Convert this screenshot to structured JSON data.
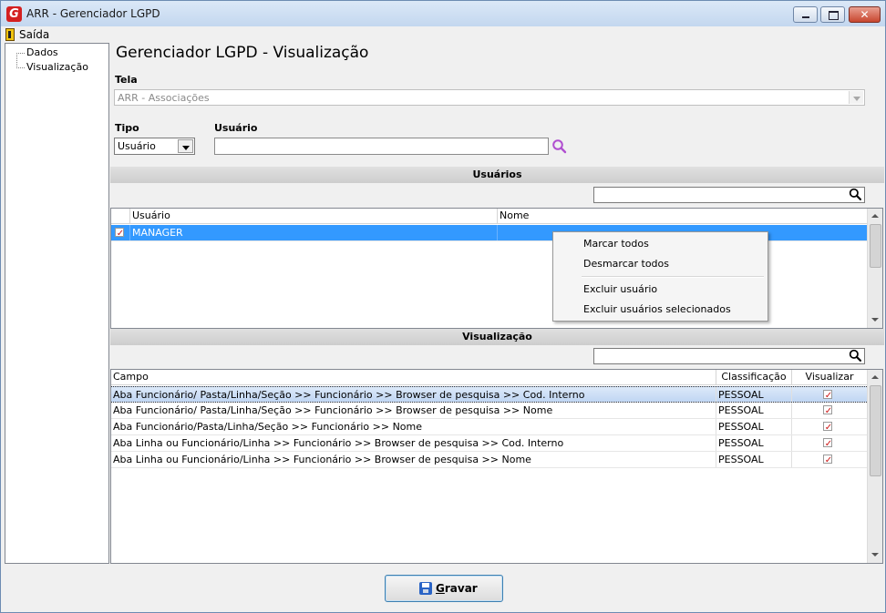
{
  "window": {
    "title": "ARR - Gerenciador LGPD",
    "icon_letter": "G"
  },
  "menu": {
    "exit_label": "Saída"
  },
  "sidebar": {
    "items": [
      {
        "label": "Dados"
      },
      {
        "label": "Visualização"
      }
    ]
  },
  "page": {
    "title": "Gerenciador LGPD - Visualização"
  },
  "form": {
    "tela_label": "Tela",
    "tela_value": "ARR - Associações",
    "tipo_label": "Tipo",
    "tipo_value": "Usuário",
    "usuario_label": "Usuário",
    "usuario_value": ""
  },
  "users_section": {
    "title": "Usuários",
    "filter_value": "",
    "columns": [
      "Usuário",
      "Nome"
    ],
    "rows": [
      {
        "usuario": "MANAGER",
        "nome": "",
        "checked": true
      }
    ]
  },
  "context_menu": {
    "items": [
      "Marcar todos",
      "Desmarcar todos",
      "Excluir usuário",
      "Excluir usuários selecionados"
    ]
  },
  "view_section": {
    "title": "Visualização",
    "filter_value": "",
    "columns": [
      "Campo",
      "Classificação",
      "Visualizar"
    ],
    "rows": [
      {
        "campo": "Aba Funcionário/ Pasta/Linha/Seção >> Funcionário >> Browser de pesquisa >> Cod. Interno",
        "classificacao": "PESSOAL",
        "visualizar": true
      },
      {
        "campo": "Aba Funcionário/ Pasta/Linha/Seção >> Funcionário >> Browser de pesquisa >> Nome",
        "classificacao": "PESSOAL",
        "visualizar": true
      },
      {
        "campo": "Aba Funcionário/Pasta/Linha/Seção >> Funcionário >> Nome",
        "classificacao": "PESSOAL",
        "visualizar": true
      },
      {
        "campo": "Aba Linha ou Funcionário/Linha >> Funcionário >> Browser de pesquisa >> Cod. Interno",
        "classificacao": "PESSOAL",
        "visualizar": true
      },
      {
        "campo": "Aba Linha ou Funcionário/Linha >> Funcionário >> Browser de pesquisa >> Nome",
        "classificacao": "PESSOAL",
        "visualizar": true
      }
    ]
  },
  "actions": {
    "save_label": "Gravar",
    "save_mnemonic": "G"
  },
  "colors": {
    "selection": "#3399ff",
    "checkmark": "#cc1111",
    "search_icon": "#b04fd0"
  }
}
